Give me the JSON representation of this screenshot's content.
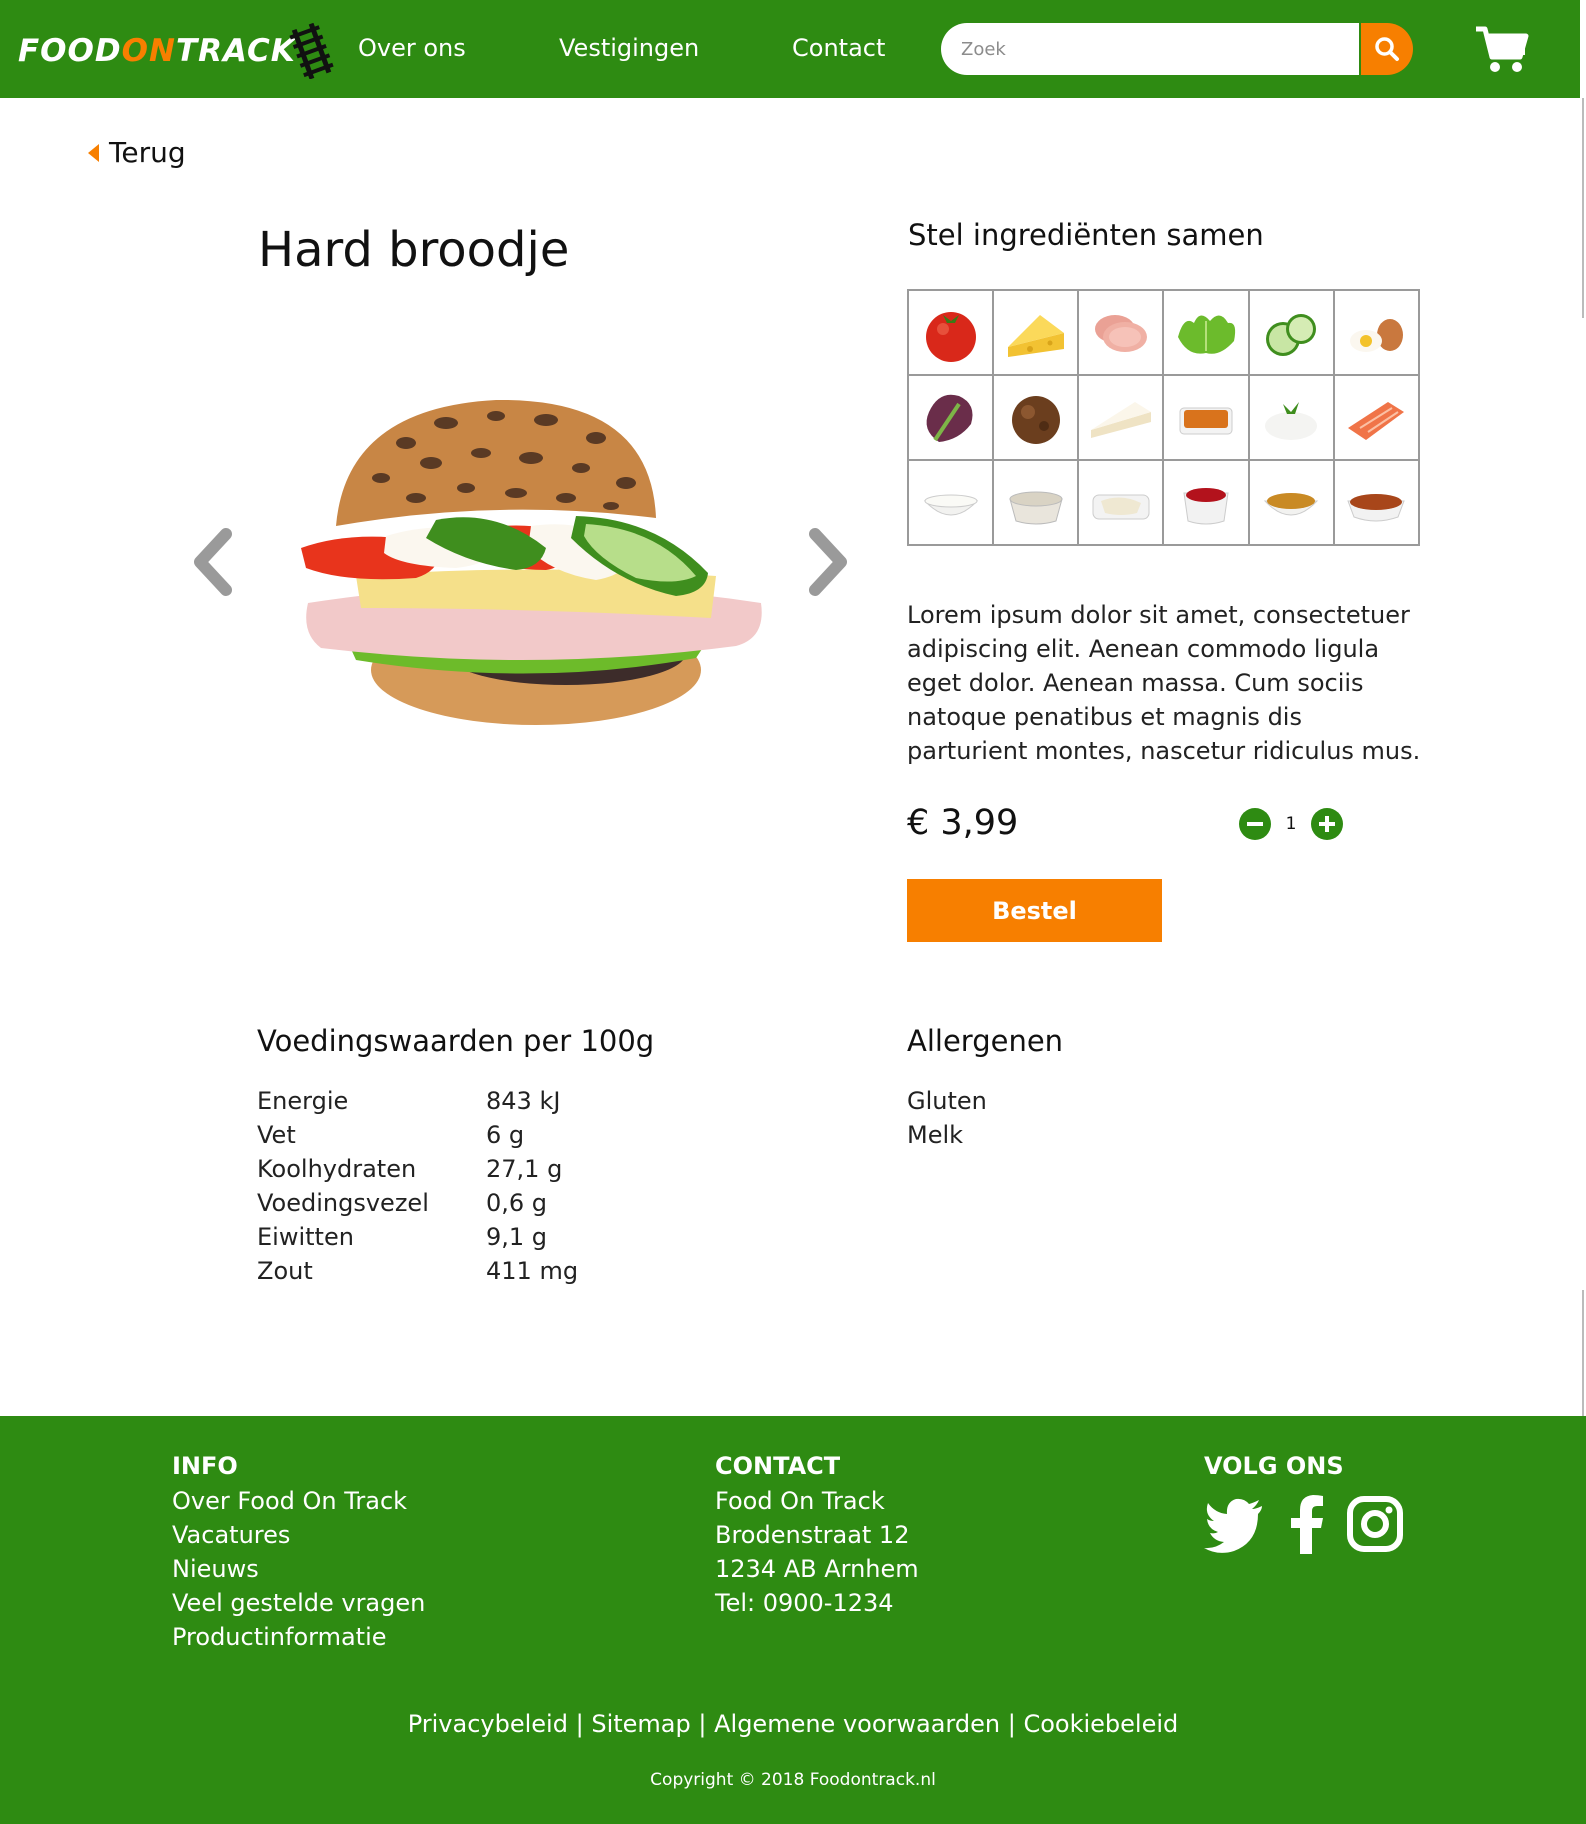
{
  "header": {
    "logo_part1": "FOOD",
    "logo_part2": "ON",
    "logo_part3": "TRACK",
    "nav": [
      "Over ons",
      "Vestigingen",
      "Contact"
    ],
    "search_placeholder": "Zoek",
    "brand_color": "#2e8b12",
    "accent_color": "#f77f00"
  },
  "back_label": "Terug",
  "product": {
    "title": "Hard broodje",
    "description": "Lorem ipsum dolor sit amet, consectetuer adipiscing elit. Aenean commodo ligula eget dolor. Aenean massa. Cum sociis natoque penatibus et magnis dis parturient montes, nascetur ridiculus mus.",
    "price": "€ 3,99",
    "quantity": "1",
    "order_label": "Bestel"
  },
  "ingredients": {
    "title": "Stel ingrediënten samen",
    "items": [
      "tomato-icon",
      "cheese-icon",
      "ham-icon",
      "lettuce-icon",
      "cucumber-icon",
      "egg-icon",
      "red-lettuce-icon",
      "meatball-icon",
      "brie-icon",
      "sauce-tray-icon",
      "rice-icon",
      "salmon-icon",
      "mayo-bowl-icon",
      "dressing-bowl-icon",
      "salad-tray-icon",
      "ketchup-bowl-icon",
      "mustard-bowl-icon",
      "brown-sauce-icon"
    ]
  },
  "nutrition": {
    "title": "Voedingswaarden per 100g",
    "rows": [
      {
        "name": "Energie",
        "value": "843 kJ"
      },
      {
        "name": "Vet",
        "value": "6 g"
      },
      {
        "name": "Koolhydraten",
        "value": "27,1 g"
      },
      {
        "name": "Voedingsvezel",
        "value": "0,6 g"
      },
      {
        "name": "Eiwitten",
        "value": "9,1 g"
      },
      {
        "name": "Zout",
        "value": "411 mg"
      }
    ]
  },
  "allergens": {
    "title": "Allergenen",
    "items": [
      "Gluten",
      "Melk"
    ]
  },
  "footer": {
    "info_title": "INFO",
    "info_links": [
      "Over Food On Track",
      "Vacatures",
      "Nieuws",
      "Veel gestelde vragen",
      "Productinformatie"
    ],
    "contact_title": "CONTACT",
    "contact_lines": [
      "Food On Track",
      "Brodenstraat 12",
      "1234 AB Arnhem",
      "Tel: 0900-1234"
    ],
    "follow_title": "VOLG ONS",
    "social": [
      "twitter-icon",
      "facebook-icon",
      "instagram-icon"
    ],
    "legal_links": [
      "Privacybeleid",
      "Sitemap",
      "Algemene voorwaarden",
      "Cookiebeleid"
    ],
    "legal_sep": "|",
    "copyright": "Copyright © 2018 Foodontrack.nl"
  }
}
